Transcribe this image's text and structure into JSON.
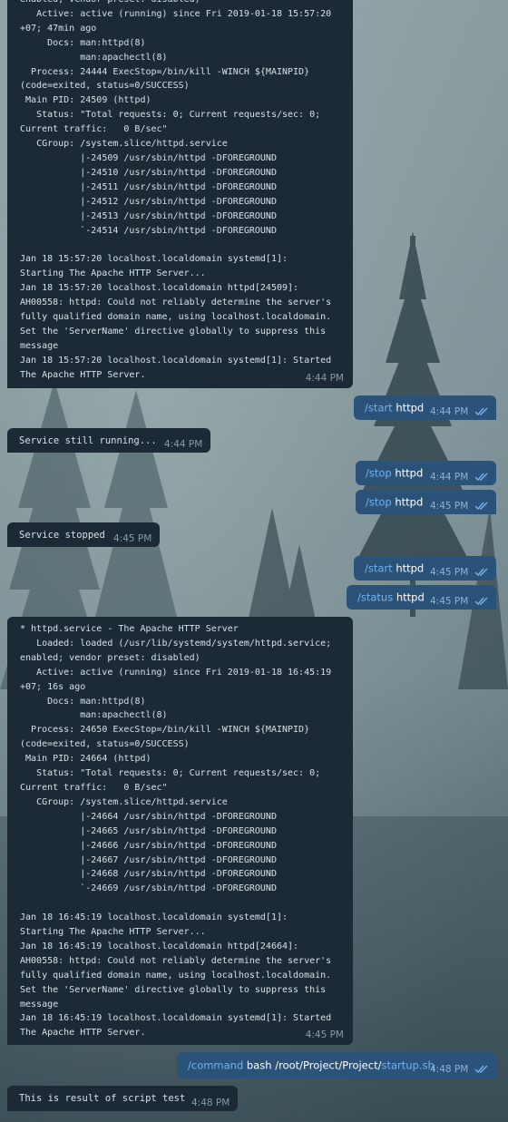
{
  "bubble1": {
    "lines": [
      "enabled; vendor preset: disabled)",
      "   Active: active (running) since Fri 2019-01-18 15:57:20",
      "+07; 47min ago",
      "     Docs: man:httpd(8)",
      "           man:apachectl(8)",
      "  Process: 24444 ExecStop=/bin/kill -WINCH ${MAINPID}",
      "(code=exited, status=0/SUCCESS)",
      " Main PID: 24509 (httpd)",
      "   Status: \"Total requests: 0; Current requests/sec: 0;",
      "Current traffic:   0 B/sec\"",
      "   CGroup: /system.slice/httpd.service",
      "           |-24509 /usr/sbin/httpd -DFOREGROUND",
      "           |-24510 /usr/sbin/httpd -DFOREGROUND",
      "           |-24511 /usr/sbin/httpd -DFOREGROUND",
      "           |-24512 /usr/sbin/httpd -DFOREGROUND",
      "           |-24513 /usr/sbin/httpd -DFOREGROUND",
      "           `-24514 /usr/sbin/httpd -DFOREGROUND",
      "",
      "Jan 18 15:57:20 localhost.localdomain systemd[1]:",
      "Starting The Apache HTTP Server...",
      "Jan 18 15:57:20 localhost.localdomain httpd[24509]:",
      "AH00558: httpd: Could not reliably determine the server's",
      "fully qualified domain name, using localhost.localdomain.",
      "Set the 'ServerName' directive globally to suppress this",
      "message",
      "Jan 18 15:57:20 localhost.localdomain systemd[1]: Started",
      "The Apache HTTP Server."
    ],
    "time": "4:44 PM"
  },
  "out1": {
    "slash": "/start",
    "arg": " httpd",
    "time": "4:44 PM"
  },
  "in2": {
    "text": "Service still running...",
    "time": "4:44 PM"
  },
  "out2": {
    "slash": "/stop",
    "arg": " httpd",
    "time": "4:44 PM"
  },
  "out3": {
    "slash": "/stop",
    "arg": " httpd",
    "time": "4:45 PM"
  },
  "in3": {
    "text": "Service stopped",
    "time": "4:45 PM"
  },
  "out4": {
    "slash": "/start",
    "arg": " httpd",
    "time": "4:45 PM"
  },
  "out5": {
    "slash": "/status",
    "arg": " httpd",
    "time": "4:45 PM"
  },
  "bubble2": {
    "lines": [
      "* httpd.service - The Apache HTTP Server",
      "   Loaded: loaded (/usr/lib/systemd/system/httpd.service;",
      "enabled; vendor preset: disabled)",
      "   Active: active (running) since Fri 2019-01-18 16:45:19",
      "+07; 16s ago",
      "     Docs: man:httpd(8)",
      "           man:apachectl(8)",
      "  Process: 24650 ExecStop=/bin/kill -WINCH ${MAINPID}",
      "(code=exited, status=0/SUCCESS)",
      " Main PID: 24664 (httpd)",
      "   Status: \"Total requests: 0; Current requests/sec: 0;",
      "Current traffic:   0 B/sec\"",
      "   CGroup: /system.slice/httpd.service",
      "           |-24664 /usr/sbin/httpd -DFOREGROUND",
      "           |-24665 /usr/sbin/httpd -DFOREGROUND",
      "           |-24666 /usr/sbin/httpd -DFOREGROUND",
      "           |-24667 /usr/sbin/httpd -DFOREGROUND",
      "           |-24668 /usr/sbin/httpd -DFOREGROUND",
      "           `-24669 /usr/sbin/httpd -DFOREGROUND",
      "",
      "Jan 18 16:45:19 localhost.localdomain systemd[1]:",
      "Starting The Apache HTTP Server...",
      "Jan 18 16:45:19 localhost.localdomain httpd[24664]:",
      "AH00558: httpd: Could not reliably determine the server's",
      "fully qualified domain name, using localhost.localdomain.",
      "Set the 'ServerName' directive globally to suppress this",
      "message",
      "Jan 18 16:45:19 localhost.localdomain systemd[1]: Started",
      "The Apache HTTP Server."
    ],
    "time": "4:45 PM"
  },
  "out6": {
    "slash": "/command",
    "arg": " bash /root/Project/Project/",
    "slash2": "startup.sh",
    "time": "4:48 PM"
  },
  "in4": {
    "text": "This is result of script test",
    "time": "4:48 PM"
  },
  "icons": {
    "read_receipt": "double-check-icon"
  },
  "colors": {
    "incoming_bubble": "#1b2a35",
    "outgoing_bubble": "#2b5278",
    "command_link": "#74b3f0",
    "check": "#74b3f0"
  }
}
